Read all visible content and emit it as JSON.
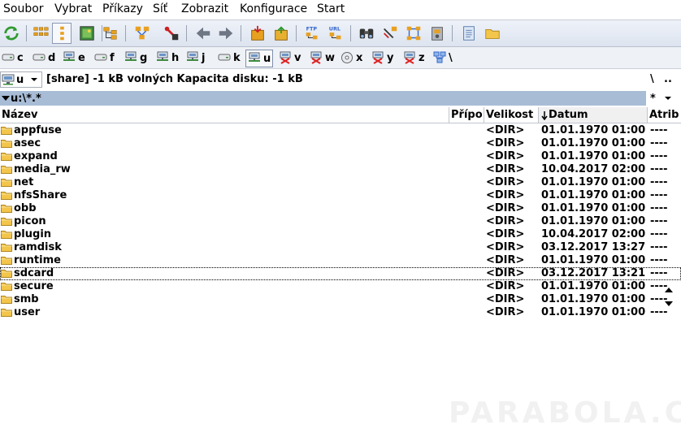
{
  "menu": [
    "Soubor",
    "Vybrat",
    "Příkazy",
    "Síť",
    "Zobrazit",
    "Konfigurace",
    "Start"
  ],
  "toolbar": {
    "icons": [
      "refresh-icon",
      "view-icons-icon",
      "view-list-icon",
      "thumbnails-icon",
      "tree-icon",
      "compare-icon",
      "select-icon",
      "back-icon",
      "forward-icon",
      "pack-icon",
      "unpack-icon",
      "ftp-icon",
      "url-icon",
      "find-icon",
      "multi-rename-icon",
      "sync-icon",
      "disk-tool-icon",
      "notepad-icon",
      "folder-icon"
    ]
  },
  "drives": [
    {
      "label": "c",
      "icon": "hdd"
    },
    {
      "label": "d",
      "icon": "hdd"
    },
    {
      "label": "e",
      "icon": "net"
    },
    {
      "label": "f",
      "icon": "hdd"
    },
    {
      "label": "g",
      "icon": "net"
    },
    {
      "label": "h",
      "icon": "net"
    },
    {
      "label": "j",
      "icon": "net"
    },
    {
      "label": "k",
      "icon": "hdd"
    },
    {
      "label": "u",
      "icon": "net-active"
    },
    {
      "label": "v",
      "icon": "net-x"
    },
    {
      "label": "w",
      "icon": "net-x"
    },
    {
      "label": "x",
      "icon": "cd"
    },
    {
      "label": "y",
      "icon": "net-x"
    },
    {
      "label": "z",
      "icon": "net-x"
    },
    {
      "label": "\\",
      "icon": "network"
    }
  ],
  "infobar": {
    "drive": "u",
    "diskinfo": "[share]  -1 kB volných  Kapacita disku: -1 kB",
    "root": "\\",
    "up": ".."
  },
  "path": "u:\\*.*",
  "filter": "*",
  "columns": {
    "name": "Název",
    "ext": "Přípo",
    "size": "Velikost",
    "date": "Datum",
    "attr": "Atrib"
  },
  "files": [
    {
      "name": "appfuse",
      "size": "<DIR>",
      "date": "01.01.1970 01:00",
      "attr": "----"
    },
    {
      "name": "asec",
      "size": "<DIR>",
      "date": "01.01.1970 01:00",
      "attr": "----"
    },
    {
      "name": "expand",
      "size": "<DIR>",
      "date": "01.01.1970 01:00",
      "attr": "----"
    },
    {
      "name": "media_rw",
      "size": "<DIR>",
      "date": "10.04.2017 02:00",
      "attr": "----"
    },
    {
      "name": "net",
      "size": "<DIR>",
      "date": "01.01.1970 01:00",
      "attr": "----"
    },
    {
      "name": "nfsShare",
      "size": "<DIR>",
      "date": "01.01.1970 01:00",
      "attr": "----"
    },
    {
      "name": "obb",
      "size": "<DIR>",
      "date": "01.01.1970 01:00",
      "attr": "----"
    },
    {
      "name": "picon",
      "size": "<DIR>",
      "date": "01.01.1970 01:00",
      "attr": "----"
    },
    {
      "name": "plugin",
      "size": "<DIR>",
      "date": "10.04.2017 02:00",
      "attr": "----"
    },
    {
      "name": "ramdisk",
      "size": "<DIR>",
      "date": "03.12.2017 13:27",
      "attr": "----"
    },
    {
      "name": "runtime",
      "size": "<DIR>",
      "date": "01.01.1970 01:00",
      "attr": "----"
    },
    {
      "name": "sdcard",
      "size": "<DIR>",
      "date": "03.12.2017 13:21",
      "attr": "----",
      "focused": true
    },
    {
      "name": "secure",
      "size": "<DIR>",
      "date": "01.01.1970 01:00",
      "attr": "----"
    },
    {
      "name": "smb",
      "size": "<DIR>",
      "date": "01.01.1970 01:00",
      "attr": "----"
    },
    {
      "name": "user",
      "size": "<DIR>",
      "date": "01.01.1970 01:00",
      "attr": "----"
    }
  ],
  "watermark": "PARABOLA.CZ",
  "colors": {
    "path_bar": "#a8bcd6",
    "folder": "#f3c54a",
    "toolbar_bg": "#dde4ef"
  }
}
